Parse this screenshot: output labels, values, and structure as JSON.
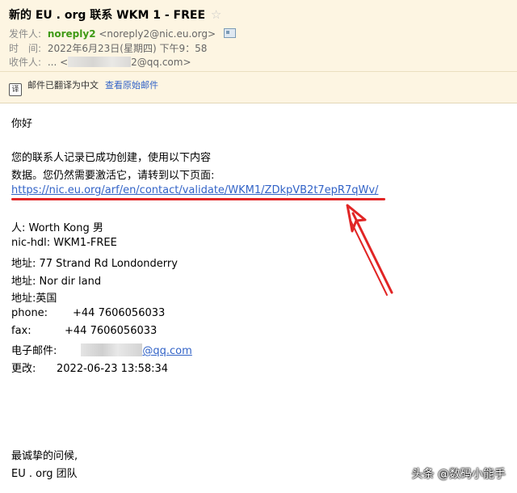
{
  "header": {
    "subject": "新的 EU . org 联系 WKM 1 - FREE",
    "star_icon": "star-outline-icon",
    "from_label": "发件人:",
    "from_name": "noreply2",
    "from_address": "<noreply2@nic.eu.org>",
    "contact_card_icon": "contact-card-icon",
    "time_label": "时　间:",
    "time_value": "2022年6月23日(星期四) 下午9：58",
    "to_label": "收件人:",
    "to_prefix": "... <",
    "to_suffix": "2@qq.com>"
  },
  "translate_bar": {
    "icon": "translate-icon",
    "icon_glyph": "译",
    "translated_text": "邮件已翻译为中文",
    "view_original": "查看原始邮件"
  },
  "body": {
    "greeting": "你好",
    "intro_line1": "您的联系人记录已成功创建，使用以下内容",
    "intro_line2": "数据。您仍然需要激活它，请转到以下页面:",
    "activation_link": "https://nic.eu.org/arf/en/contact/validate/WKM1/ZDkpVB2t7epR7qWv/",
    "person": "人: Worth Kong 男",
    "nic_hdl": "nic-hdl: WKM1-FREE",
    "address1": "地址: 77 Strand Rd Londonderry",
    "address2": "地址: Nor dir land",
    "address3": "地址:英国",
    "phone_label": "phone:",
    "phone_value": "+44 7606056033",
    "fax_label": "fax:",
    "fax_value": "+44 7606056033",
    "email_label": "电子邮件:",
    "email_suffix": "@qq.com",
    "changed_label": "更改:",
    "changed_value": "2022-06-23 13:58:34",
    "closing": "最诚挚的问候,",
    "team": "EU . org 团队"
  },
  "annotation": {
    "underline_color": "#e12525",
    "arrow_color": "#e12525"
  },
  "watermark": "头条 @数码小能手"
}
